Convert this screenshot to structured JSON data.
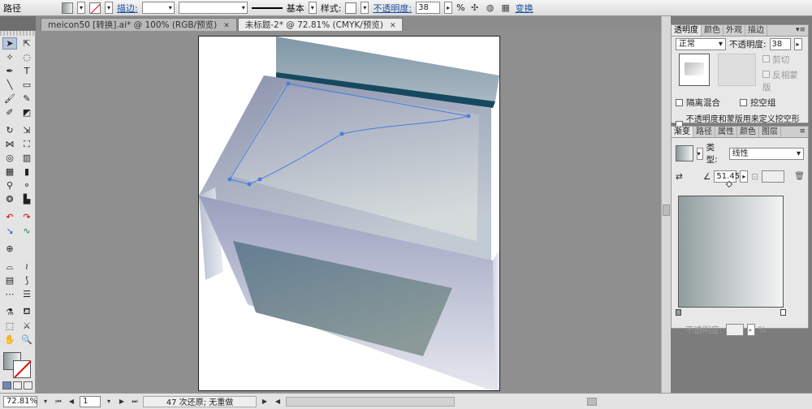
{
  "control_bar": {
    "selection_label": "路径",
    "stroke_label": "描边:",
    "profile_label": "基本",
    "style_label": "样式:",
    "opacity_label": "不透明度:",
    "opacity_value": "38",
    "opacity_unit": "%",
    "transform_label": "变换"
  },
  "doc_tabs": [
    {
      "title": "meicon50 [转换].ai* @ 100% (RGB/预览)",
      "close": "✕"
    },
    {
      "title": "未标题-2* @ 72.81% (CMYK/预览)",
      "close": "✕"
    }
  ],
  "transparency_panel": {
    "tabs": [
      "透明度",
      "颜色",
      "外观",
      "描边"
    ],
    "blend_mode": "正常",
    "opacity_label": "不透明度:",
    "opacity_value": "38",
    "clip_label": "剪切",
    "invert_label": "反相蒙版",
    "isolate_label": "隔离混合",
    "knockout_label": "挖空组",
    "opacity_mask_label": "不透明度和蒙版用来定义挖空形状"
  },
  "gradient_panel": {
    "tabs": [
      "渐变",
      "路径",
      "属性",
      "颜色",
      "图层"
    ],
    "type_label": "类型:",
    "type_value": "线性",
    "angle_value": "51.45",
    "opacity_label": "不透明度:",
    "opacity_unit": "%"
  },
  "status_bar": {
    "zoom": "72.81%",
    "artboard": "1",
    "status_text": "47 次还原; 无重做"
  },
  "colors": {
    "gradient_start": "#8f9d9d",
    "gradient_end": "#f3f4f4",
    "path_highlight": "#4a7ee0"
  }
}
